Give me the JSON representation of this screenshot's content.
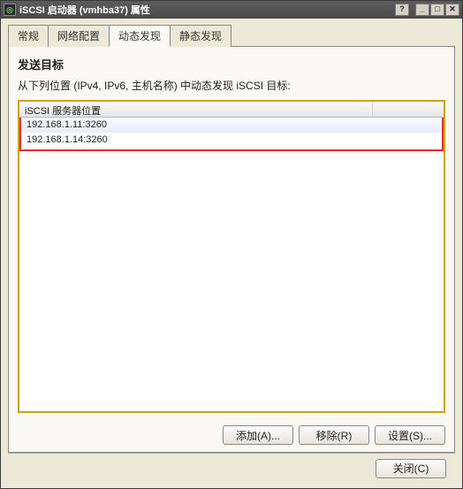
{
  "titlebar": {
    "title": "iSCSI 启动器 (vmhba37) 属性"
  },
  "tabs": [
    {
      "label": "常规"
    },
    {
      "label": "网络配置"
    },
    {
      "label": "动态发现"
    },
    {
      "label": "静态发现"
    }
  ],
  "active_tab_index": 2,
  "panel": {
    "heading": "发送目标",
    "subtext": "从下列位置 (IPv4, IPv6, 主机名称) 中动态发现 iSCSI 目标:",
    "column_header": "iSCSI 服务器位置",
    "rows": [
      "192.168.1.11:3260",
      "192.168.1.14:3260"
    ],
    "buttons": {
      "add": "添加(A)...",
      "remove": "移除(R)",
      "settings": "设置(S)..."
    }
  },
  "footer": {
    "close": "关闭(C)"
  }
}
